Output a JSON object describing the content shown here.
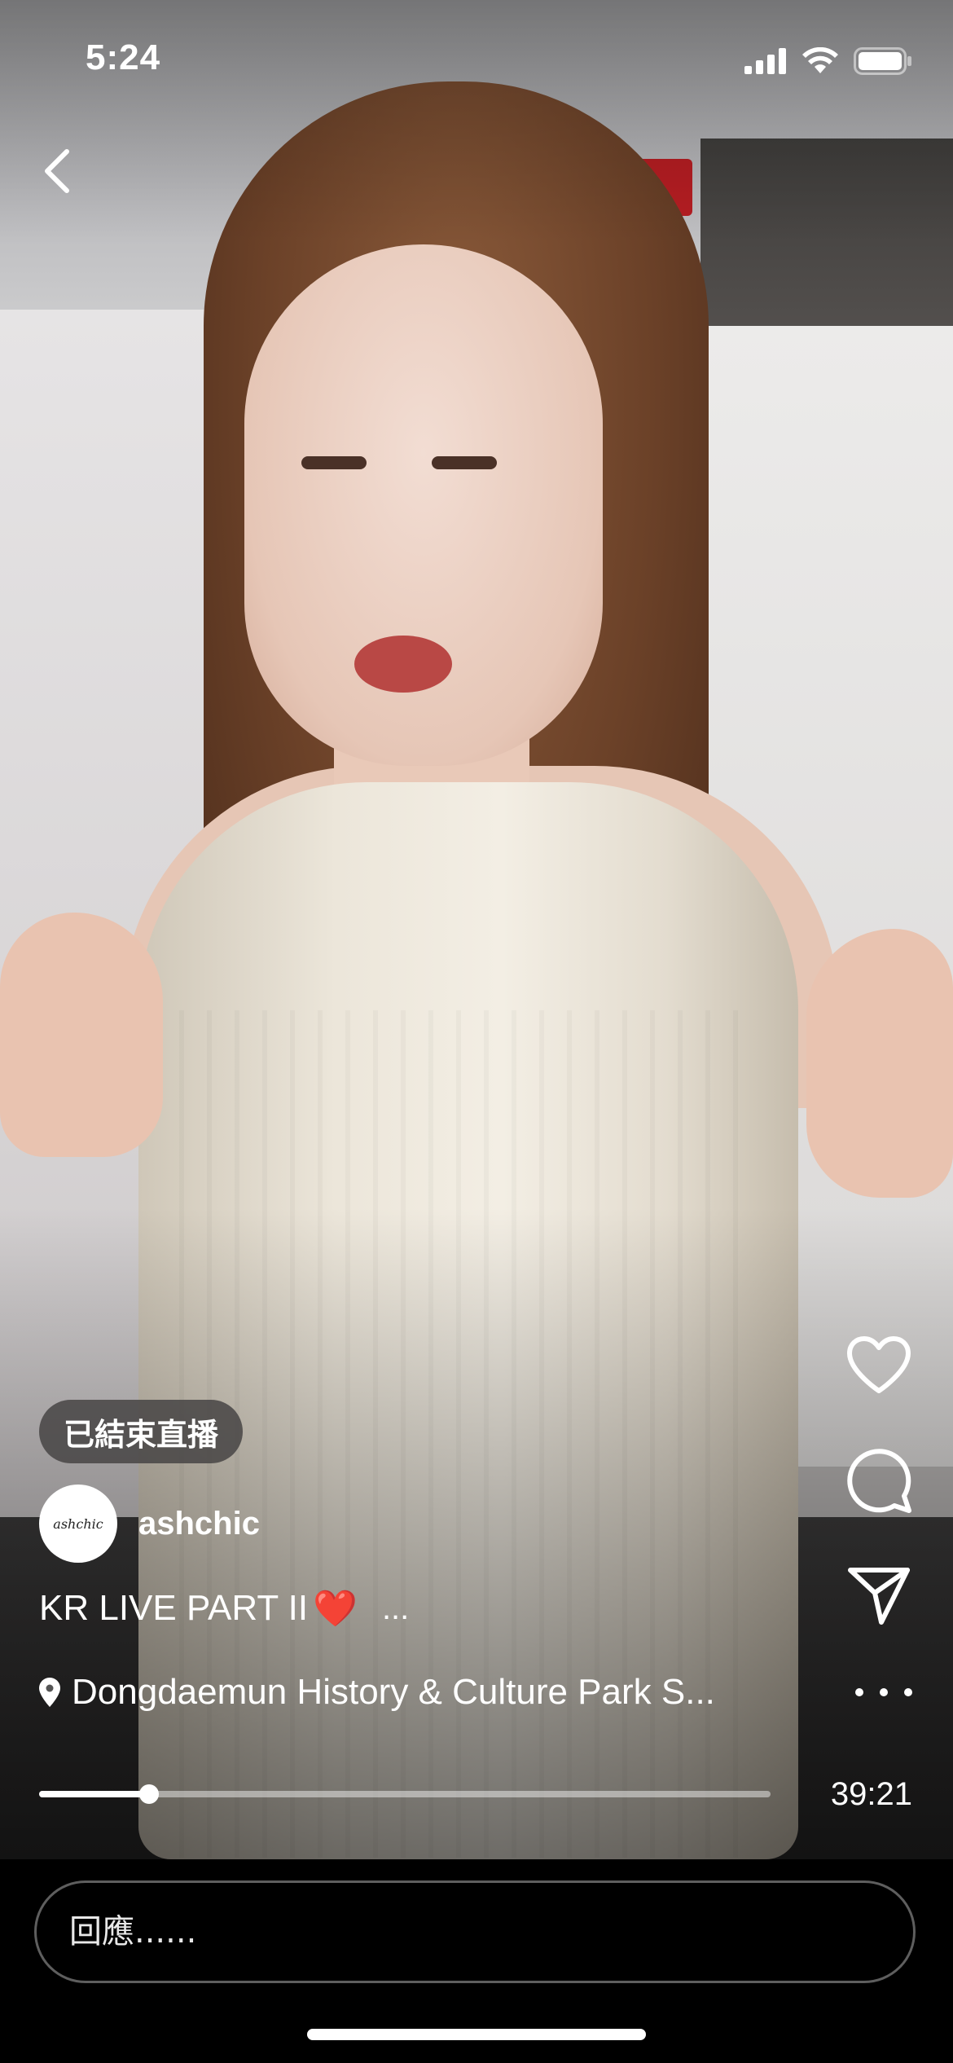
{
  "status_bar": {
    "time": "5:24"
  },
  "live": {
    "ended_badge": "已結束直播",
    "username": "ashchic",
    "avatar_text": "ashchic",
    "caption": "KR LIVE PART II",
    "caption_emoji": "❤️",
    "caption_more": "...",
    "location": "Dongdaemun History & Culture Park S...",
    "progress_fraction": 0.15,
    "duration": "39:21"
  },
  "reply": {
    "placeholder": "回應......"
  },
  "icons": {
    "back": "chevron-left-icon",
    "like": "heart-icon",
    "comment": "comment-bubble-icon",
    "share": "paper-plane-icon",
    "more": "more-dots-icon",
    "location": "location-pin-icon"
  }
}
